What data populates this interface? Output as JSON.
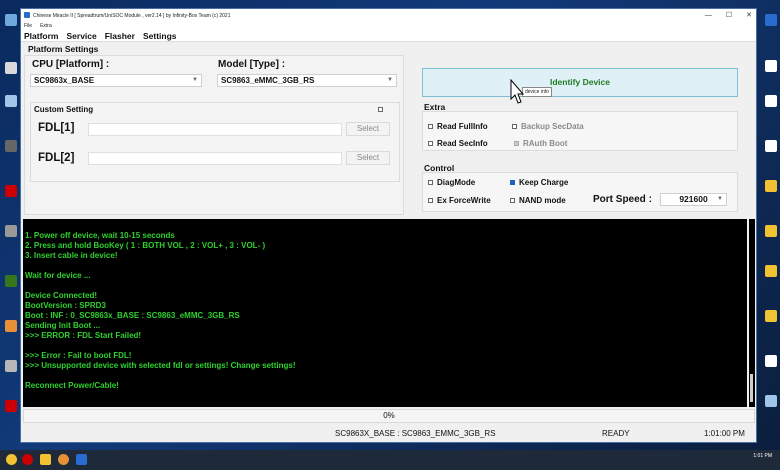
{
  "window": {
    "title": "Chinese Miracle II [ Spreadtrum/UniSOC Module , ver2.14 ] by Infinity-Box Team (c) 2021",
    "controls": [
      "—",
      "☐",
      "✕"
    ]
  },
  "menu": [
    "File",
    "Extra"
  ],
  "tabs": [
    "Platform",
    "Service",
    "Flasher",
    "Settings"
  ],
  "platform_settings": {
    "title": "Platform Settings",
    "cpu_label": "CPU [Platform] :",
    "cpu_value": "SC9863x_BASE",
    "model_label": "Model [Type] :",
    "model_value": "SC9863_eMMC_3GB_RS",
    "custom_setting_label": "Custom Setting",
    "fdl1_label": "FDL[1]",
    "fdl2_label": "FDL[2]",
    "select_label": "Select"
  },
  "identify_button": "Identify Device",
  "tooltip": "device info",
  "extra": {
    "title": "Extra",
    "read_fullinfo": "Read FullInfo",
    "backup_secdata": "Backup SecData",
    "read_secinfo": "Read SecInfo",
    "rauth_boot": "RAuth Boot"
  },
  "control": {
    "title": "Control",
    "diagmode": "DiagMode",
    "keep_charge": "Keep Charge",
    "ex_forcewrite": "Ex ForceWrite",
    "nand_mode": "NAND mode",
    "port_speed_label": "Port Speed :",
    "port_speed_value": "921600"
  },
  "log": [
    "1. Power off device, wait 10-15 seconds",
    "2. Press and hold BooKey ( 1 : BOTH VOL , 2 : VOL+ , 3 : VOL- )",
    "3. Insert cable in device!",
    "",
    "Wait for device ...",
    "",
    "Device Connected!",
    "BootVersion : SPRD3",
    "Boot : INF : 0_SC9863x_BASE : SC9863_eMMC_3GB_RS",
    "Sending Init Boot ...",
    ">>>   ERROR : FDL Start Failed!",
    "",
    ">>>   Error : Fail to boot FDL!",
    ">>>   Unsupported device with selected fdl or settings! Change settings!",
    "",
    "Reconnect Power/Cable!"
  ],
  "progress": {
    "label": "0%",
    "value": 0
  },
  "status": {
    "platform": "SC9863X_BASE : SC9863_EMMC_3GB_RS",
    "state": "READY",
    "time": "1:01:00 PM"
  },
  "taskbar": {
    "clock": "1:01 PM"
  },
  "colors": {
    "log_text": "#2ed12e",
    "identify_bg": "#dff0f6",
    "identify_text": "#1f7a24"
  }
}
